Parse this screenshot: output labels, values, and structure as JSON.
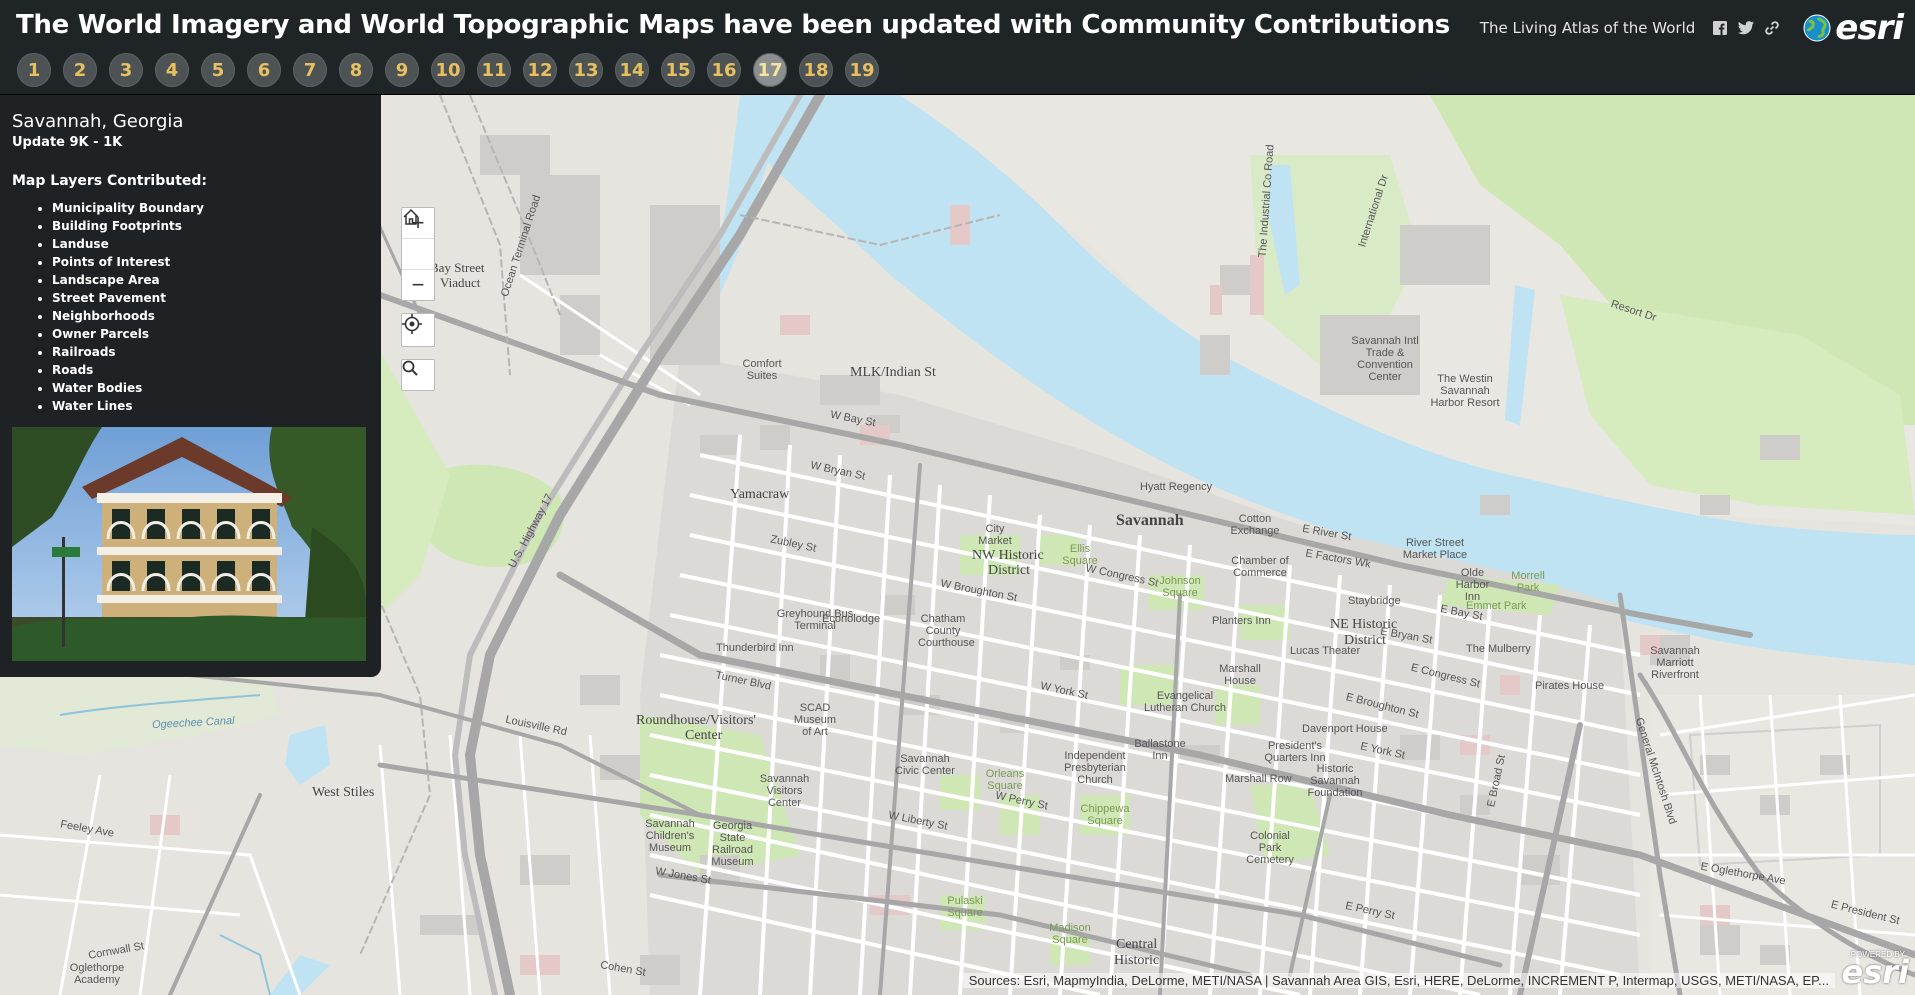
{
  "header": {
    "title": "The World Imagery and World Topographic Maps have been updated with Community Contributions",
    "atlas_link": "The Living Atlas of the World",
    "social_icons": [
      "facebook-icon",
      "twitter-icon",
      "link-icon"
    ],
    "logo_text": "esri"
  },
  "tabs": [
    "1",
    "2",
    "3",
    "4",
    "5",
    "6",
    "7",
    "8",
    "9",
    "10",
    "11",
    "12",
    "13",
    "14",
    "15",
    "16",
    "17",
    "18",
    "19"
  ],
  "active_tab": "17",
  "panel": {
    "place": "Savannah, Georgia",
    "update": "Update 9K - 1K",
    "layers_heading": "Map Layers Contributed:",
    "layers": [
      "Municipality Boundary",
      "Building Footprints",
      "Landuse",
      "Points of Interest",
      "Landscape Area",
      "Street Pavement",
      "Neighborhoods",
      "Owner Parcels",
      "Railroads",
      "Roads",
      "Water Bodies",
      "Water Lines"
    ]
  },
  "map": {
    "labels": {
      "savannah": "Savannah",
      "nw_historic": "NW Historic",
      "district": "District",
      "ne_historic": "NE Historic",
      "ne_district": "District",
      "yamacraw": "Yamacraw",
      "mlk": "MLK/Indian St",
      "bay_street": "Bay Street",
      "viaduct": "Viaduct",
      "roundhouse": "Roundhouse/Visitors'",
      "center": "Center",
      "west_stiles": "West Stiles",
      "central_historic": "Central",
      "historic": "Historic",
      "w_bay_st": "W Bay St",
      "w_broughton": "W Broughton St",
      "w_liberty": "W Liberty St",
      "e_bay_st": "E Bay St",
      "e_broughton": "E Broughton St",
      "e_broad": "E Broad St",
      "louisville": "Louisville Rd",
      "resort_dr": "Resort Dr",
      "us_highway": "U.S. Highway 17",
      "ogeechee": "Ogeechee Canal",
      "general": "General McIntosh Blvd",
      "e_president": "E President St",
      "hyatt": "Hyatt Regency",
      "trade_center": "Savannah Intl Trade & Convention Center",
      "westin": "The Westin Savannah Harbor Resort",
      "marriott": "Savannah Marriott Riverfront",
      "johnson_sq": "Johnson Square",
      "ellis_sq": "Ellis Square",
      "city_market": "City Market",
      "chamber": "Chamber of Commerce",
      "cotton_exchange": "Cotton Exchange",
      "colonial_park": "Colonial Park Cemetery",
      "chippewa": "Chippewa Square",
      "orleans": "Orleans Square",
      "pulaski": "Pulaski Square",
      "madison": "Madison Square",
      "comfort_suites": "Comfort Suites",
      "greyhound": "Greyhound Bus Terminal",
      "econolodge": "Econolodge",
      "thunderbird": "Thunderbird Inn",
      "scad": "SCAD Museum of Art",
      "childrens": "Savannah Children's Museum",
      "railroad_museum": "Georgia State Railroad Museum",
      "civic_center": "Savannah Civic Center",
      "visitors_center": "Savannah Visitors Center",
      "chatham": "Chatham County Courthouse",
      "planters": "Planters Inn",
      "lucas": "Lucas Theater",
      "mulberry": "The Mulberry",
      "pirates": "Pirates House",
      "emmet": "Emmet Park",
      "morrell": "Morrell Park",
      "river_street": "River Street Market Place",
      "olde_harbor": "Olde Harbor Inn",
      "oglethorpe": "Oglethorpe Academy",
      "e_oglethorpe": "E Oglethorpe Ave",
      "w_jones": "W Jones St",
      "e_river": "E River St",
      "e_factors": "E Factors Wk",
      "stay_bridge": "Staybridge",
      "e_bryan": "E Bryan St",
      "e_congress": "E Congress St",
      "e_york": "E York St",
      "w_york": "W York St",
      "w_perry": "W Perry St",
      "e_perry": "E Perry St",
      "w_congress": "W Congress St",
      "w_bryan": "W Bryan St",
      "independent": "Independent Presbyterian Church",
      "evangelical": "Evangelical Lutheran Church",
      "ballastone": "Ballastone Inn",
      "presidents": "President's Quarters Inn",
      "marshall": "Marshall House",
      "marshall_row": "Marshall Row",
      "davenport": "Davenport House",
      "historic_foundation": "Historic Savannah Foundation",
      "cohen": "Cohen St",
      "feeley": "Feeley Ave",
      "cornwall": "Cornwall St",
      "resort": "Resort Dr",
      "industrial": "The Industrial Co Road",
      "international": "International Dr",
      "ocean_terminal": "Ocean Terminal Road",
      "zubley": "Zubley St",
      "turner": "Turner Blvd"
    }
  },
  "attribution": "Sources: Esri, MapmyIndia, DeLorme, METI/NASA | Savannah Area GIS, Esri, HERE, DeLorme, INCREMENT P, Intermap, USGS, METI/NASA, EP...",
  "powered_by": "POWERED BY",
  "powered_logo": "esri",
  "colors": {
    "header_bg": "#1f2426",
    "tab_bg": "#4d5254",
    "tab_active_bg": "#8c8f90",
    "tab_text": "#e8c060",
    "water": "#bfe3f2",
    "park": "#cfe7b5",
    "land": "#e6e4df"
  }
}
